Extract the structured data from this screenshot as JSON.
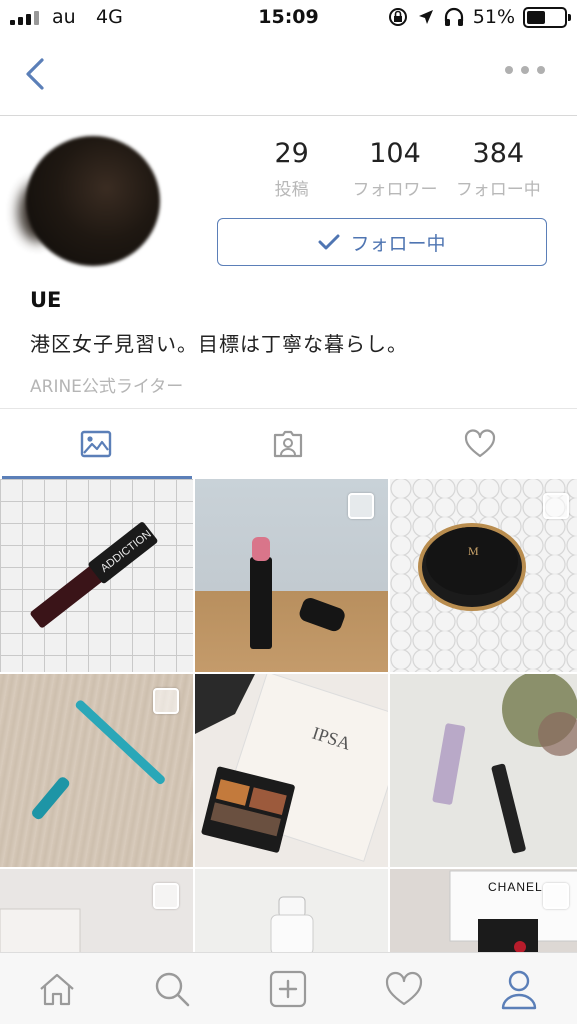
{
  "status": {
    "carrier": "au",
    "network": "4G",
    "time": "15:09",
    "battery": "51%",
    "battery_level": 0.51
  },
  "profile": {
    "posts_count": "29",
    "posts_label": "投稿",
    "followers_count": "104",
    "followers_label": "フォロワー",
    "following_count": "384",
    "following_label": "フォロー中",
    "follow_button_label": "フォロー中",
    "username": "UE",
    "bio": "港区女子見習い。目標は丁寧な暮らし。",
    "writer_badge": "ARINE公式ライター"
  },
  "tabs": [
    {
      "icon": "image-icon",
      "active": true
    },
    {
      "icon": "portrait-icon",
      "active": false
    },
    {
      "icon": "heart-icon",
      "active": false
    }
  ],
  "grid_texts": {
    "addiction": "ADDICTION",
    "ipsa": "IPSA",
    "chanel": "CHANEL"
  },
  "bottom_nav": [
    "home-icon",
    "search-icon",
    "add-post-icon",
    "likes-icon",
    "profile-icon"
  ],
  "colors": {
    "accent": "#5b7fb8",
    "muted": "#b8b8b8"
  }
}
